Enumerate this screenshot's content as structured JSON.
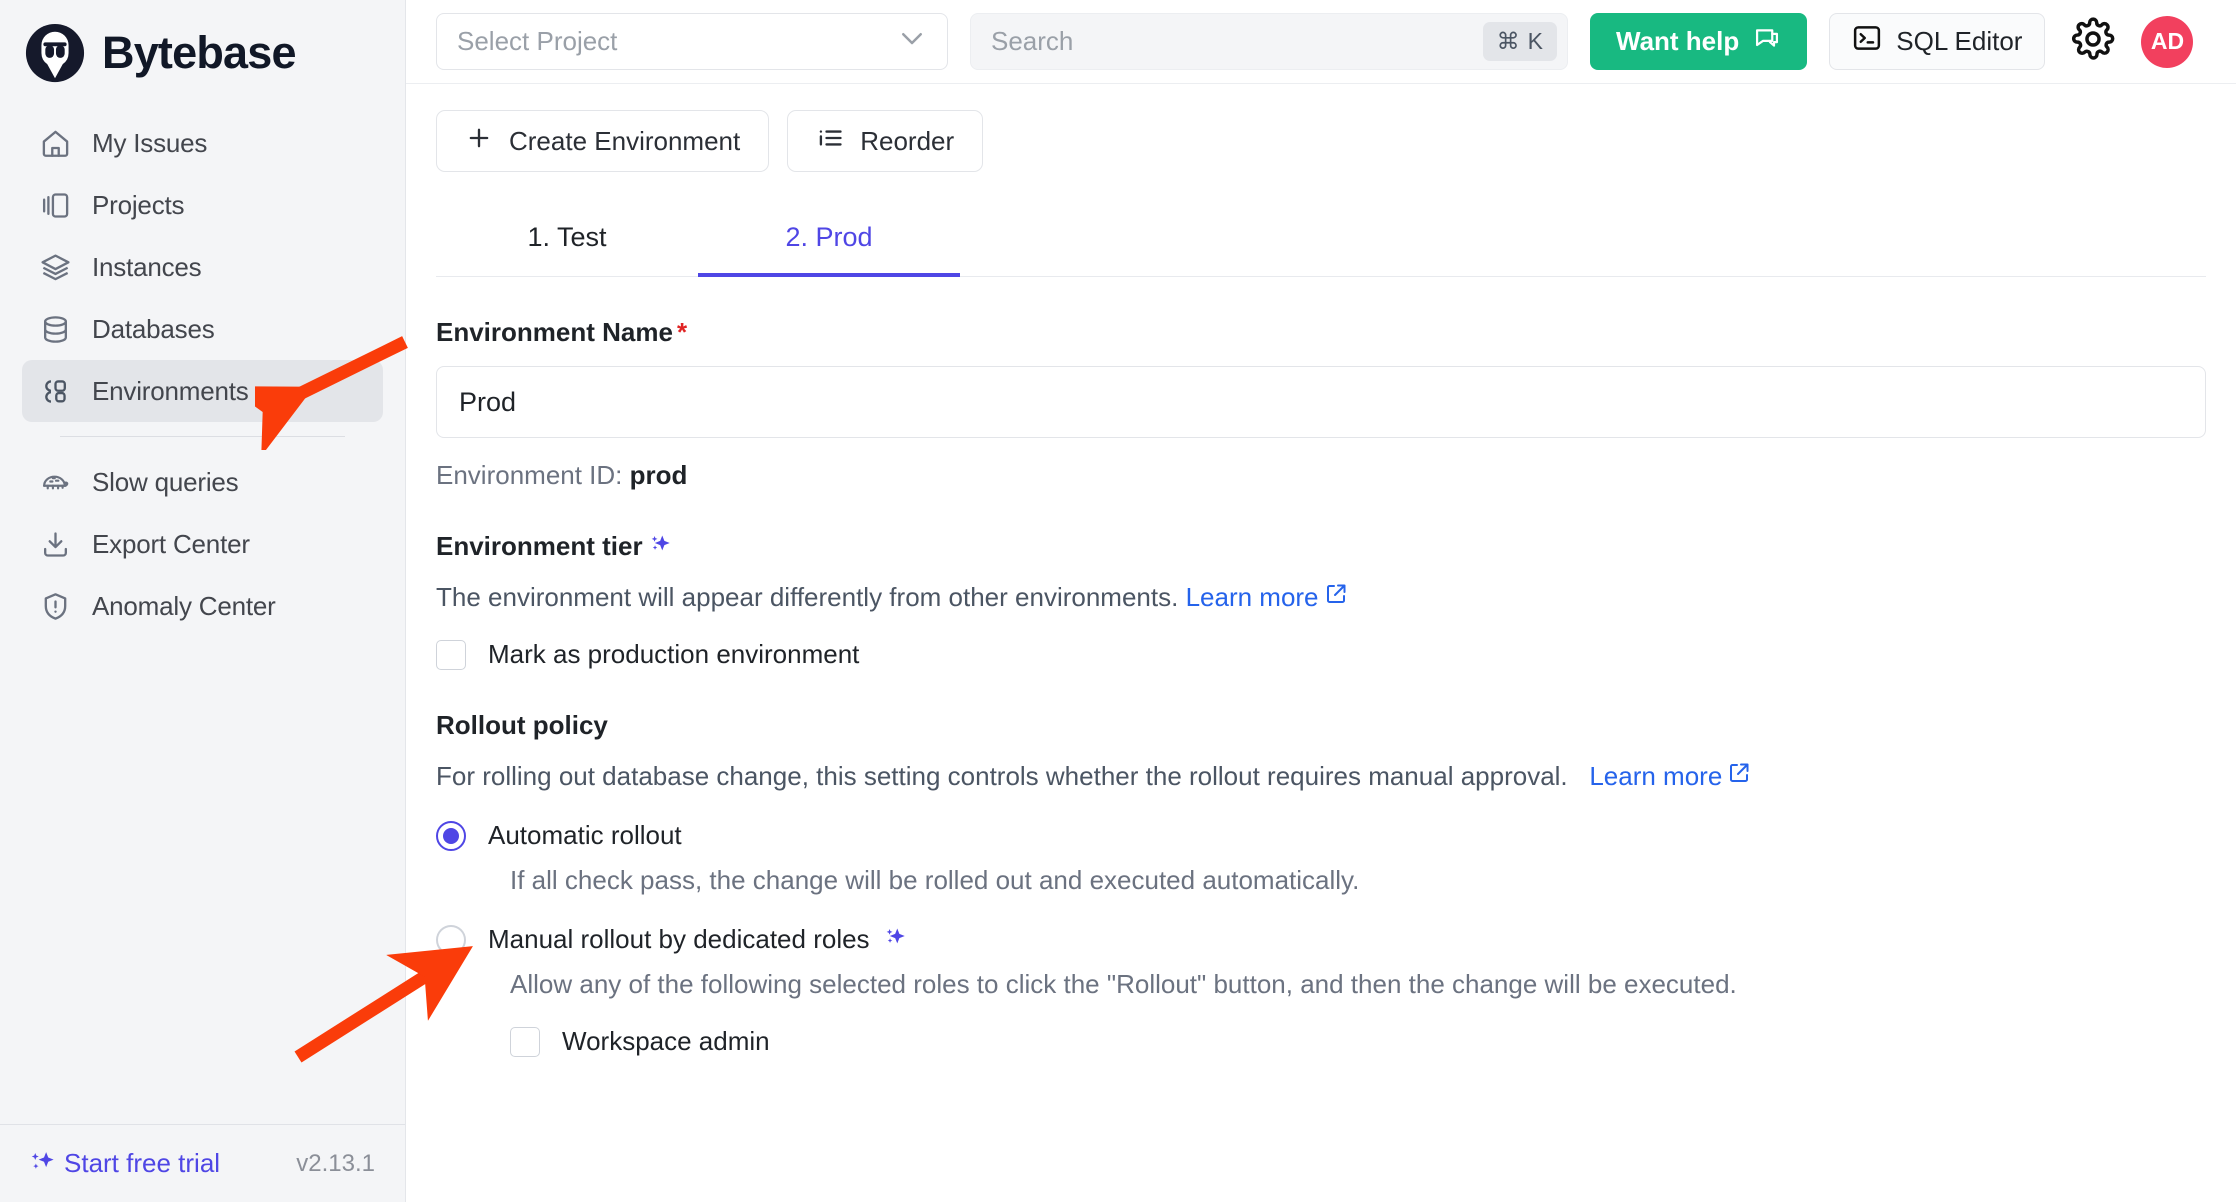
{
  "brand": {
    "name": "Bytebase",
    "logo_icon": "bytebase-logo-icon"
  },
  "sidebar": {
    "items": [
      {
        "label": "My Issues",
        "icon": "home-icon",
        "active": false
      },
      {
        "label": "Projects",
        "icon": "projects-icon",
        "active": false
      },
      {
        "label": "Instances",
        "icon": "layers-icon",
        "active": false
      },
      {
        "label": "Databases",
        "icon": "database-icon",
        "active": false
      },
      {
        "label": "Environments",
        "icon": "environments-icon",
        "active": true
      }
    ],
    "items_secondary": [
      {
        "label": "Slow queries",
        "icon": "turtle-icon"
      },
      {
        "label": "Export Center",
        "icon": "download-icon"
      },
      {
        "label": "Anomaly Center",
        "icon": "shield-alert-icon"
      }
    ],
    "footer": {
      "trial_label": "Start free trial",
      "trial_icon": "sparkle-icon",
      "version": "v2.13.1"
    }
  },
  "topbar": {
    "project_select": {
      "placeholder": "Select Project",
      "chevron_icon": "chevron-down-icon"
    },
    "search": {
      "placeholder": "Search",
      "shortcut_cmd": "⌘",
      "shortcut_key": "K"
    },
    "want_help": {
      "label": "Want help",
      "icon": "speech-bubble-icon",
      "color": "#18b981"
    },
    "sql_editor": {
      "label": "SQL Editor",
      "icon": "terminal-icon"
    },
    "settings": {
      "icon": "gear-icon"
    },
    "avatar": {
      "initials": "AD",
      "color": "#f2405e"
    }
  },
  "actions": {
    "create_environment": {
      "label": "Create Environment",
      "icon": "plus-icon"
    },
    "reorder": {
      "label": "Reorder",
      "icon": "list-ordered-icon"
    }
  },
  "tabs": [
    {
      "label": "1. Test",
      "active": false
    },
    {
      "label": "2. Prod",
      "active": true
    }
  ],
  "form": {
    "name_label": "Environment Name",
    "name_required_mark": "*",
    "name_value": "Prod",
    "env_id_prefix": "Environment ID:",
    "env_id_value": "prod"
  },
  "environment_tier": {
    "title": "Environment tier",
    "premium_icon": "sparkle-icon",
    "description": "The environment will appear differently from other environments.",
    "learn_more": "Learn more",
    "external_icon": "external-link-icon",
    "checkbox_label": "Mark as production environment",
    "checkbox_checked": false
  },
  "rollout_policy": {
    "title": "Rollout policy",
    "description": "For rolling out database change, this setting controls whether the rollout requires manual approval.",
    "learn_more": "Learn more",
    "external_icon": "external-link-icon",
    "options": [
      {
        "label": "Automatic rollout",
        "selected": true,
        "description": "If all check pass, the change will be rolled out and executed automatically.",
        "premium": false
      },
      {
        "label": "Manual rollout by dedicated roles",
        "selected": false,
        "description": "Allow any of the following selected roles to click the \"Rollout\" button, and then the change will be executed.",
        "premium": true,
        "premium_icon": "sparkle-icon",
        "roles": [
          {
            "label": "Workspace admin",
            "checked": false
          }
        ]
      }
    ]
  },
  "annotations": {
    "arrow_color": "#fa3c0a",
    "arrow_1_target": "sidebar-item-environments",
    "arrow_2_target": "automatic-rollout-radio"
  }
}
